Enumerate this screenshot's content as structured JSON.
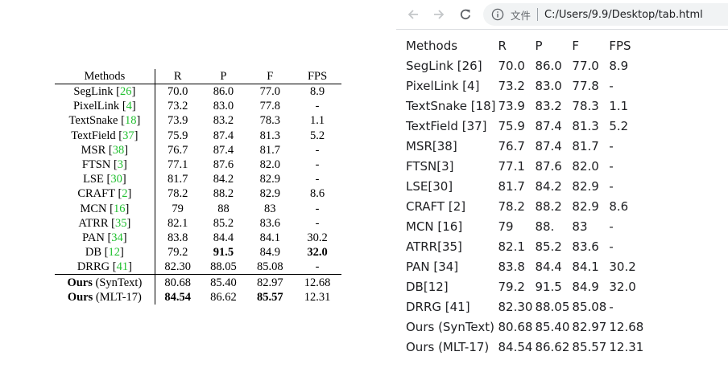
{
  "paper_table": {
    "headers": [
      "Methods",
      "R",
      "P",
      "F",
      "FPS"
    ],
    "rows": [
      {
        "name": "SegLink",
        "ref": "26",
        "r": "70.0",
        "p": "86.0",
        "f": "77.0",
        "fps": "8.9"
      },
      {
        "name": "PixelLink",
        "ref": "4",
        "r": "73.2",
        "p": "83.0",
        "f": "77.8",
        "fps": "-"
      },
      {
        "name": "TextSnake",
        "ref": "18",
        "r": "73.9",
        "p": "83.2",
        "f": "78.3",
        "fps": "1.1"
      },
      {
        "name": "TextField",
        "ref": "37",
        "r": "75.9",
        "p": "87.4",
        "f": "81.3",
        "fps": "5.2"
      },
      {
        "name": "MSR",
        "ref": "38",
        "r": "76.7",
        "p": "87.4",
        "f": "81.7",
        "fps": "-"
      },
      {
        "name": "FTSN",
        "ref": "3",
        "r": "77.1",
        "p": "87.6",
        "f": "82.0",
        "fps": "-"
      },
      {
        "name": "LSE",
        "ref": "30",
        "r": "81.7",
        "p": "84.2",
        "f": "82.9",
        "fps": "-"
      },
      {
        "name": "CRAFT",
        "ref": "2",
        "r": "78.2",
        "p": "88.2",
        "f": "82.9",
        "fps": "8.6"
      },
      {
        "name": "MCN",
        "ref": "16",
        "r": "79",
        "p": "88",
        "f": "83",
        "fps": "-"
      },
      {
        "name": "ATRR",
        "ref": "35",
        "r": "82.1",
        "p": "85.2",
        "f": "83.6",
        "fps": "-"
      },
      {
        "name": "PAN",
        "ref": "34",
        "r": "83.8",
        "p": "84.4",
        "f": "84.1",
        "fps": "30.2"
      },
      {
        "name": "DB",
        "ref": "12",
        "r": "79.2",
        "p": "91.5",
        "f": "84.9",
        "fps": "32.0"
      },
      {
        "name": "DRRG",
        "ref": "41",
        "r": "82.30",
        "p": "88.05",
        "f": "85.08",
        "fps": "-"
      }
    ],
    "ours": [
      {
        "name": "Ours",
        "suffix": "(SynText)",
        "r": "80.68",
        "p": "85.40",
        "f": "82.97",
        "fps": "12.68"
      },
      {
        "name": "Ours",
        "suffix": "(MLT-17)",
        "r": "84.54",
        "p": "86.62",
        "f": "85.57",
        "fps": "12.31"
      }
    ]
  },
  "browser": {
    "file_chip": "文件",
    "url": "C:/Users/9.9/Desktop/tab.html",
    "icons": {
      "back": "back-arrow-icon",
      "forward": "forward-arrow-icon",
      "reload": "reload-icon",
      "info": "info-icon"
    },
    "table": {
      "headers": [
        "Methods",
        "R",
        "P",
        "F",
        "FPS"
      ],
      "rows": [
        [
          "SegLink [26]",
          "70.0",
          "86.0",
          "77.0",
          "8.9"
        ],
        [
          "PixelLink [4]",
          "73.2",
          "83.0",
          "77.8",
          "-"
        ],
        [
          "TextSnake [18]",
          "73.9",
          "83.2",
          "78.3",
          "1.1"
        ],
        [
          "TextField [37]",
          "75.9",
          "87.4",
          "81.3",
          "5.2"
        ],
        [
          "MSR[38]",
          "76.7",
          "87.4",
          "81.7",
          "-"
        ],
        [
          "FTSN[3]",
          "77.1",
          "87.6",
          "82.0",
          "-"
        ],
        [
          "LSE[30]",
          "81.7",
          "84.2",
          "82.9",
          "-"
        ],
        [
          "CRAFT [2]",
          "78.2",
          "88.2",
          "82.9",
          "8.6"
        ],
        [
          "MCN [16]",
          "79",
          "88.",
          "83",
          "-"
        ],
        [
          "ATRR[35]",
          "82.1",
          "85.2",
          "83.6",
          "-"
        ],
        [
          "PAN [34]",
          "83.8",
          "84.4",
          "84.1",
          "30.2"
        ],
        [
          "DB[12]",
          "79.2",
          "91.5",
          "84.9",
          "32.0"
        ],
        [
          "DRRG [41]",
          "82.30",
          "88.05",
          "85.08",
          "-"
        ],
        [
          "Ours (SynText)",
          "80.68",
          "85.40",
          "82.97",
          "12.68"
        ],
        [
          "Ours (MLT-17)",
          "84.54",
          "86.62",
          "85.57",
          "12.31"
        ]
      ]
    }
  }
}
